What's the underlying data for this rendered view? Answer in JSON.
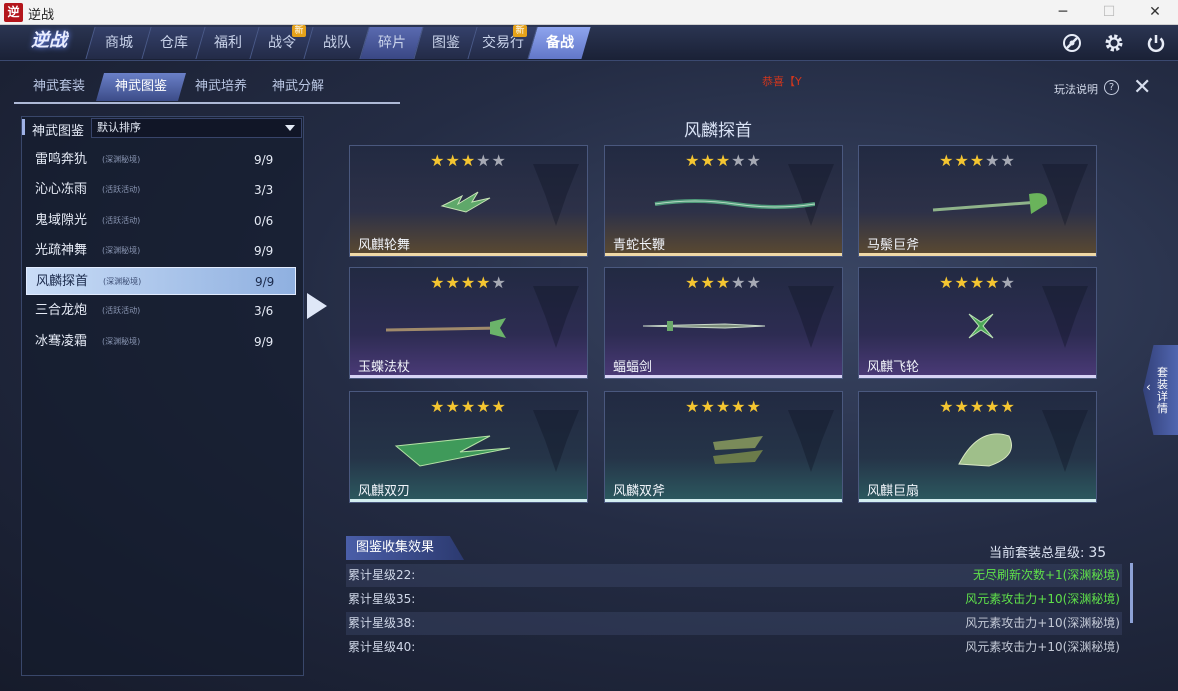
{
  "window": {
    "title": "逆战",
    "app_icon_text": "逆",
    "minimize": "─",
    "maximize": "☐",
    "close": "✕"
  },
  "logo": "逆战",
  "nav": {
    "tabs": [
      {
        "label": "商城",
        "badge": ""
      },
      {
        "label": "仓库",
        "badge": ""
      },
      {
        "label": "福利",
        "badge": ""
      },
      {
        "label": "战令",
        "badge": "新"
      },
      {
        "label": "战队",
        "badge": ""
      },
      {
        "label": "碎片",
        "badge": ""
      },
      {
        "label": "图鉴",
        "badge": ""
      },
      {
        "label": "交易行",
        "badge": "新"
      },
      {
        "label": "备战",
        "badge": ""
      }
    ],
    "active_index": 8
  },
  "subtabs": [
    "神武套装",
    "神武图鉴",
    "神武培养",
    "神武分解"
  ],
  "marquee": "恭喜【Y",
  "help_label": "玩法说明",
  "help_icon": "?",
  "close_icon": "✕",
  "left_panel": {
    "label": "神武图鉴",
    "sort": "默认排序",
    "items": [
      {
        "name": "雷鸣奔犰",
        "tag": "(深渊秘境)",
        "count": "9/9"
      },
      {
        "name": "沁心冻雨",
        "tag": "(活跃活动)",
        "count": "3/3"
      },
      {
        "name": "鬼域隙光",
        "tag": "(活跃活动)",
        "count": "0/6"
      },
      {
        "name": "光疏神舞",
        "tag": "(深渊秘境)",
        "count": "9/9"
      },
      {
        "name": "风麟探首",
        "tag": "(深渊秘境)",
        "count": "9/9"
      },
      {
        "name": "三合龙炮",
        "tag": "(活跃活动)",
        "count": "3/6"
      },
      {
        "name": "冰骞凌霜",
        "tag": "(深渊秘境)",
        "count": "9/9"
      }
    ],
    "selected_index": 4
  },
  "set_title": "风麟探首",
  "cards": [
    {
      "name": "风麒轮舞",
      "stars": 3,
      "tier": "gold"
    },
    {
      "name": "青蛇长鞭",
      "stars": 3,
      "tier": "gold"
    },
    {
      "name": "马鬃巨斧",
      "stars": 3,
      "tier": "gold"
    },
    {
      "name": "玉蝶法杖",
      "stars": 4,
      "tier": "purple"
    },
    {
      "name": "蝠蝠剑",
      "stars": 3,
      "tier": "purple"
    },
    {
      "name": "风麒飞轮",
      "stars": 4,
      "tier": "purple"
    },
    {
      "name": "风麒双刃",
      "stars": 5,
      "tier": "teal"
    },
    {
      "name": "风麟双斧",
      "stars": 5,
      "tier": "teal"
    },
    {
      "name": "风麒巨扇",
      "stars": 5,
      "tier": "teal"
    }
  ],
  "bonus": {
    "tab_label": "图鉴收集效果",
    "total_label": "当前套装总星级:",
    "total_value": "35",
    "rows": [
      {
        "label": "累计星级22:",
        "effect": "无尽刷新次数+1(深渊秘境)",
        "active": true
      },
      {
        "label": "累计星级35:",
        "effect": "风元素攻击力+10(深渊秘境)",
        "active": true
      },
      {
        "label": "累计星级38:",
        "effect": "风元素攻击力+10(深渊秘境)",
        "active": false
      },
      {
        "label": "累计星级40:",
        "effect": "风元素攻击力+10(深渊秘境)",
        "active": false
      }
    ],
    "active_color": "#5fe04a",
    "inactive_color": "#c3c9d6"
  },
  "side_tab": "套装详情"
}
